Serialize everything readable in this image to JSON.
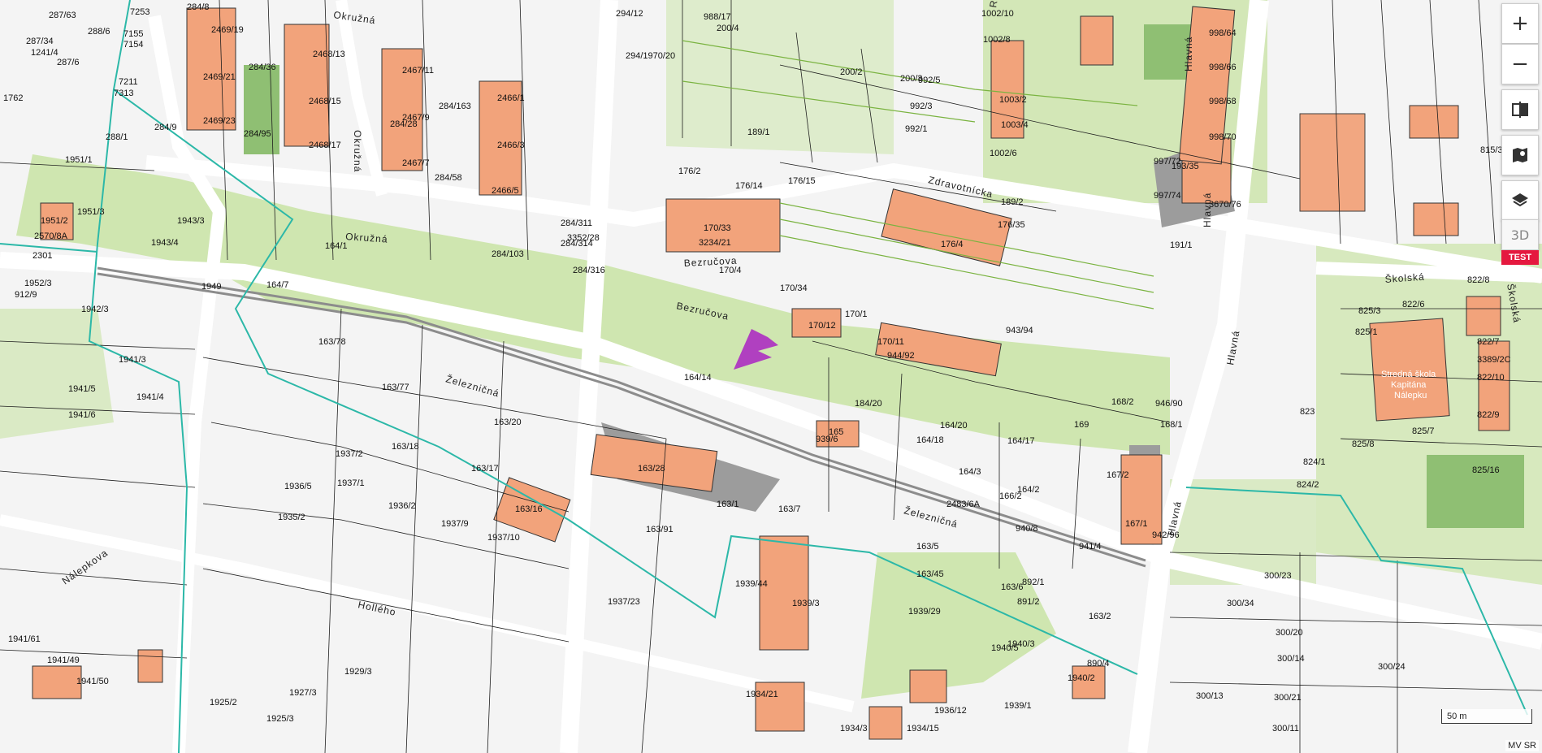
{
  "map": {
    "streets": [
      {
        "id": "zeleznicna-1",
        "text": "Železničná"
      },
      {
        "id": "zeleznicna-2",
        "text": "Železničná"
      },
      {
        "id": "bezrucova-1",
        "text": "Bezručova"
      },
      {
        "id": "bezrucova-2",
        "text": "Bezručova"
      },
      {
        "id": "zdravotnicka",
        "text": "Zdravotnícka"
      },
      {
        "id": "okruzna-1",
        "text": "Okružná"
      },
      {
        "id": "okruzna-2",
        "text": "Okružná"
      },
      {
        "id": "okruzna-3",
        "text": "Okružná"
      },
      {
        "id": "hlavna-1",
        "text": "Hlavná"
      },
      {
        "id": "hlavna-2",
        "text": "Hlavná"
      },
      {
        "id": "hlavna-3",
        "text": "Hlavná"
      },
      {
        "id": "hlavna-4",
        "text": "Hlavná"
      },
      {
        "id": "skolska-1",
        "text": "Školská"
      },
      {
        "id": "skolska-2",
        "text": "Školská"
      },
      {
        "id": "hollého",
        "text": "Hollého"
      },
      {
        "id": "ruzova",
        "text": "Ružová"
      },
      {
        "id": "nalepkova",
        "text": "Nálepkova"
      }
    ],
    "parcels": [
      {
        "n": "287/63"
      },
      {
        "n": "7253"
      },
      {
        "n": "7155"
      },
      {
        "n": "7154"
      },
      {
        "n": "1241/4"
      },
      {
        "n": "287/34"
      },
      {
        "n": "287/6"
      },
      {
        "n": "288/6"
      },
      {
        "n": "7211"
      },
      {
        "n": "7313"
      },
      {
        "n": "288/1"
      },
      {
        "n": "1762"
      },
      {
        "n": "1951/1"
      },
      {
        "n": "1951/3"
      },
      {
        "n": "1951/2"
      },
      {
        "n": "2570/8A"
      },
      {
        "n": "2301"
      },
      {
        "n": "1952/3"
      },
      {
        "n": "912/9"
      },
      {
        "n": "1942/3"
      },
      {
        "n": "1943/3"
      },
      {
        "n": "1943/4"
      },
      {
        "n": "1949"
      },
      {
        "n": "164/1"
      },
      {
        "n": "164/7"
      },
      {
        "n": "164/14"
      },
      {
        "n": "164/20"
      },
      {
        "n": "284/8"
      },
      {
        "n": "284/9"
      },
      {
        "n": "284/36"
      },
      {
        "n": "284/95"
      },
      {
        "n": "2469/19"
      },
      {
        "n": "2469/21"
      },
      {
        "n": "2469/23"
      },
      {
        "n": "2468/13"
      },
      {
        "n": "2468/15"
      },
      {
        "n": "2468/17"
      },
      {
        "n": "2467/11"
      },
      {
        "n": "2467/9"
      },
      {
        "n": "2467/7"
      },
      {
        "n": "284/163"
      },
      {
        "n": "284/58"
      },
      {
        "n": "2466/1"
      },
      {
        "n": "2466/3"
      },
      {
        "n": "2466/5"
      },
      {
        "n": "284/28"
      },
      {
        "n": "284/103"
      },
      {
        "n": "284/311"
      },
      {
        "n": "284/314"
      },
      {
        "n": "284/316"
      },
      {
        "n": "3352/28"
      },
      {
        "n": "294/12"
      },
      {
        "n": "294/1970/20"
      },
      {
        "n": "988/17"
      },
      {
        "n": "200/4"
      },
      {
        "n": "200/2"
      },
      {
        "n": "200/3"
      },
      {
        "n": "1002/10"
      },
      {
        "n": "1002/8"
      },
      {
        "n": "1002/6"
      },
      {
        "n": "1003/2"
      },
      {
        "n": "1003/4"
      },
      {
        "n": "992/5"
      },
      {
        "n": "992/3"
      },
      {
        "n": "992/1"
      },
      {
        "n": "170/33"
      },
      {
        "n": "3234/21"
      },
      {
        "n": "170/4"
      },
      {
        "n": "170/34"
      },
      {
        "n": "170/12"
      },
      {
        "n": "170/1"
      },
      {
        "n": "170/11"
      },
      {
        "n": "176/14"
      },
      {
        "n": "176/15"
      },
      {
        "n": "176/4"
      },
      {
        "n": "176/35"
      },
      {
        "n": "176/2"
      },
      {
        "n": "189/1"
      },
      {
        "n": "189/2"
      },
      {
        "n": "163/78"
      },
      {
        "n": "163/77"
      },
      {
        "n": "163/20"
      },
      {
        "n": "163/17"
      },
      {
        "n": "163/18"
      },
      {
        "n": "163/28"
      },
      {
        "n": "163/16"
      },
      {
        "n": "163/91"
      },
      {
        "n": "163/1"
      },
      {
        "n": "163/7"
      },
      {
        "n": "163/5"
      },
      {
        "n": "163/45"
      },
      {
        "n": "163/6"
      },
      {
        "n": "163/2"
      },
      {
        "n": "1937/2"
      },
      {
        "n": "1937/1"
      },
      {
        "n": "1936/5"
      },
      {
        "n": "1936/2"
      },
      {
        "n": "1935/2"
      },
      {
        "n": "1937/9"
      },
      {
        "n": "1937/10"
      },
      {
        "n": "1937/23"
      },
      {
        "n": "1939/44"
      },
      {
        "n": "1939/3"
      },
      {
        "n": "1939/29"
      },
      {
        "n": "1940/5"
      },
      {
        "n": "1940/3"
      },
      {
        "n": "165"
      },
      {
        "n": "939/6"
      },
      {
        "n": "184/20"
      },
      {
        "n": "164/18"
      },
      {
        "n": "164/17"
      },
      {
        "n": "168/2"
      },
      {
        "n": "168/1"
      },
      {
        "n": "169"
      },
      {
        "n": "167/2"
      },
      {
        "n": "167/1"
      },
      {
        "n": "166/2"
      },
      {
        "n": "164/2"
      },
      {
        "n": "164/3"
      },
      {
        "n": "2483/6A"
      },
      {
        "n": "943/94"
      },
      {
        "n": "944/92"
      },
      {
        "n": "946/90"
      },
      {
        "n": "942/96"
      },
      {
        "n": "941/4"
      },
      {
        "n": "940/8"
      },
      {
        "n": "191/1"
      },
      {
        "n": "193/35"
      },
      {
        "n": "997/72"
      },
      {
        "n": "997/74"
      },
      {
        "n": "3670/76"
      },
      {
        "n": "998/64"
      },
      {
        "n": "998/66"
      },
      {
        "n": "998/68"
      },
      {
        "n": "998/70"
      },
      {
        "n": "822/6"
      },
      {
        "n": "822/7"
      },
      {
        "n": "822/8"
      },
      {
        "n": "825/1"
      },
      {
        "n": "825/3"
      },
      {
        "n": "825/7"
      },
      {
        "n": "825/8"
      },
      {
        "n": "825/16"
      },
      {
        "n": "823"
      },
      {
        "n": "824/1"
      },
      {
        "n": "824/2"
      },
      {
        "n": "822/10"
      },
      {
        "n": "822/9"
      },
      {
        "n": "3389/2C"
      },
      {
        "n": "815/3"
      },
      {
        "n": "300/23"
      },
      {
        "n": "300/34"
      },
      {
        "n": "300/20"
      },
      {
        "n": "300/14"
      },
      {
        "n": "300/24"
      },
      {
        "n": "300/21"
      },
      {
        "n": "300/11"
      },
      {
        "n": "300/13"
      },
      {
        "n": "1941/3"
      },
      {
        "n": "1941/4"
      },
      {
        "n": "1941/5"
      },
      {
        "n": "1941/6"
      },
      {
        "n": "1941/49"
      },
      {
        "n": "1941/50"
      },
      {
        "n": "1941/61"
      },
      {
        "n": "1925/2"
      },
      {
        "n": "1925/3"
      },
      {
        "n": "1927/3"
      },
      {
        "n": "1929/3"
      },
      {
        "n": "1934/21"
      },
      {
        "n": "1934/3"
      },
      {
        "n": "1934/15"
      },
      {
        "n": "1936/12"
      },
      {
        "n": "1939/1"
      },
      {
        "n": "1940/2"
      },
      {
        "n": "890/4"
      },
      {
        "n": "891/2"
      },
      {
        "n": "892/1"
      }
    ],
    "poi": {
      "text_line1": "Stredná škola",
      "text_line2": "Kapitána",
      "text_line3": "Nálepku"
    },
    "colors": {
      "building": "#f2a37b",
      "building_border": "#333333",
      "green": "#cfe6b0",
      "ground": "#f4f4f4",
      "cadastre_line": "#1e1e1e",
      "boundary_cyan": "#2cb8a8",
      "railway": "#9a9a9a",
      "arrow": "#b040c0",
      "label_red": "#d0003a"
    }
  },
  "controls": {
    "zoom_in": "+",
    "zoom_out": "−",
    "three_d": "3D",
    "test": "TEST"
  },
  "scale": {
    "label": "50 m"
  },
  "attribution": "MV SR"
}
